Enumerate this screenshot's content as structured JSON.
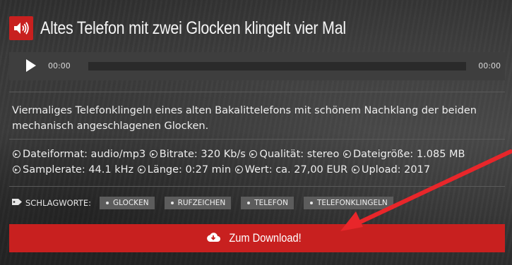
{
  "header": {
    "title": "Altes Telefon mit zwei Glocken klingelt vier Mal"
  },
  "player": {
    "current_time": "00:00",
    "duration": "00:00"
  },
  "description": "Viermaliges Telefonklingeln eines alten Bakalittelefons mit schönem Nachklang der beiden mechanisch angeschlagenen Glocken.",
  "meta": {
    "line1": [
      "Dateiformat: audio/mp3",
      "Bitrate: 320 Kb/s",
      "Qualität: stereo",
      "Dateigröße: 1.085 MB"
    ],
    "line2": [
      "Samplerate: 44.1 kHz",
      "Länge: 0:27 min",
      "Wert: ca. 27,00 EUR",
      "Upload: 2017"
    ]
  },
  "tags": {
    "label": "SCHLAGWORTE:",
    "items": [
      "GLOCKEN",
      "RUFZEICHEN",
      "TELEFON",
      "TELEFONKLINGELN"
    ]
  },
  "download": {
    "label": "Zum Download!"
  },
  "colors": {
    "accent": "#c8201f",
    "arrow": "#e8262a"
  },
  "icons": [
    "speaker-icon",
    "play-icon",
    "chevron-circle-icon",
    "tag-icon",
    "cloud-download-icon"
  ]
}
